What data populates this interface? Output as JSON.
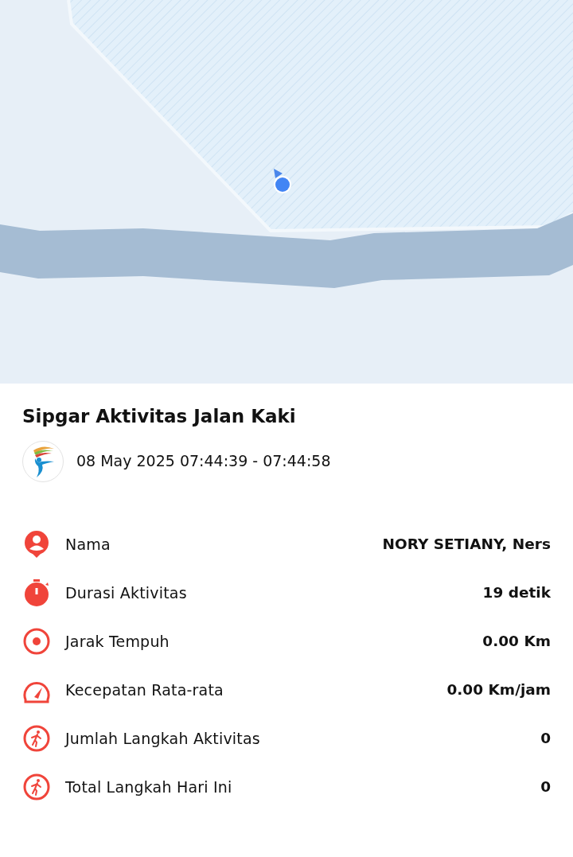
{
  "title": "Sipgar Aktivitas Jalan Kaki",
  "time_range": "08 May 2025 07:44:39 - 07:44:58",
  "stats": [
    {
      "kind": "person",
      "label": "Nama",
      "value": "NORY SETIANY, Ners"
    },
    {
      "kind": "stopwatch",
      "label": "Durasi Aktivitas",
      "value": "19 detik"
    },
    {
      "kind": "target",
      "label": "Jarak Tempuh",
      "value": "0.00 Km"
    },
    {
      "kind": "gauge",
      "label": "Kecepatan Rata-rata",
      "value": "0.00 Km/jam"
    },
    {
      "kind": "walk",
      "label": "Jumlah Langkah Aktivitas",
      "value": "0"
    },
    {
      "kind": "walk",
      "label": "Total Langkah Hari Ini",
      "value": "0"
    }
  ]
}
